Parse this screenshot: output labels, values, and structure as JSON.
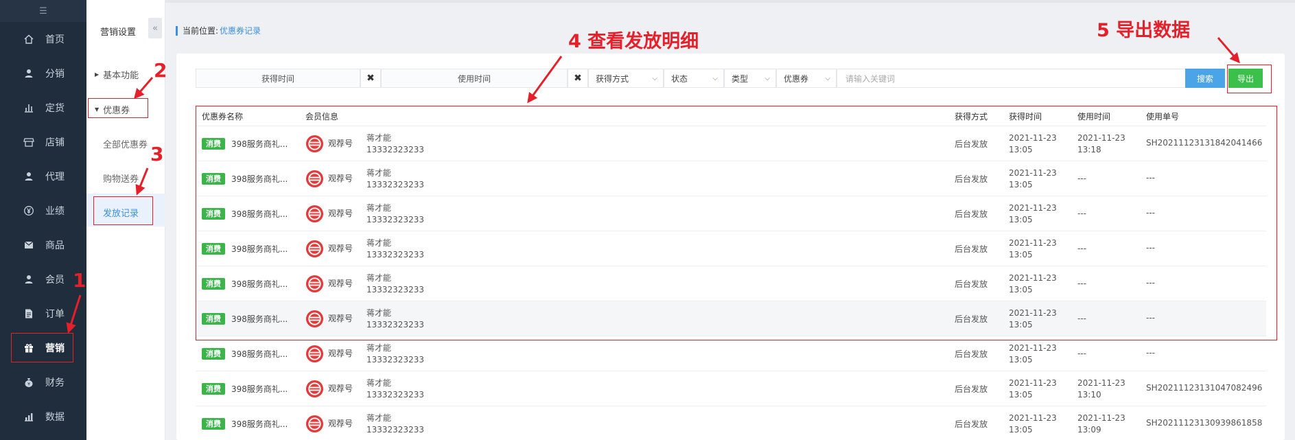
{
  "sidebar": {
    "toggle_icon": "menu-collapse-icon",
    "items": [
      {
        "label": "首页",
        "icon": "home-icon",
        "active": false
      },
      {
        "label": "分销",
        "icon": "user-icon",
        "active": false
      },
      {
        "label": "定货",
        "icon": "bar-chart-icon",
        "active": false
      },
      {
        "label": "店铺",
        "icon": "store-icon",
        "active": false
      },
      {
        "label": "代理",
        "icon": "user-icon",
        "active": false
      },
      {
        "label": "业绩",
        "icon": "yen-icon",
        "active": false
      },
      {
        "label": "商品",
        "icon": "mail-icon",
        "active": false
      },
      {
        "label": "会员",
        "icon": "user-icon",
        "active": false
      },
      {
        "label": "订单",
        "icon": "document-icon",
        "active": false
      },
      {
        "label": "营销",
        "icon": "gift-icon",
        "active": true
      },
      {
        "label": "财务",
        "icon": "money-bag-icon",
        "active": false
      },
      {
        "label": "数据",
        "icon": "stats-icon",
        "active": false
      }
    ]
  },
  "submenu": {
    "title": "营销设置",
    "collapse_icon": "double-chevron-left-icon",
    "groups": [
      {
        "label": "基本功能",
        "expanded": false
      },
      {
        "label": "优惠券",
        "expanded": true
      }
    ],
    "items": [
      {
        "label": "全部优惠券",
        "active": false
      },
      {
        "label": "购物送券",
        "active": false
      },
      {
        "label": "发放记录",
        "active": true
      }
    ]
  },
  "breadcrumb": {
    "prefix": "当前位置:",
    "current": "优惠券记录"
  },
  "filters": {
    "get_time": "获得时间",
    "use_time": "使用时间",
    "clear_symbol": "✖",
    "method": "获得方式",
    "status": "状态",
    "type": "类型",
    "coupon": "优惠券",
    "keyword_placeholder": "请输入关键词",
    "search_label": "搜索",
    "export_label": "导出"
  },
  "table": {
    "headers": {
      "name": "优惠券名称",
      "member": "会员信息",
      "method": "获得方式",
      "get_time": "获得时间",
      "use_time": "使用时间",
      "order_no": "使用单号"
    },
    "rows": [
      {
        "tag": "消费",
        "name": "398服务商礼...",
        "brand": "观荐号",
        "member_name": "蒋才能",
        "phone": "13332323233",
        "method": "后台发放",
        "get_date": "2021-11-23",
        "get_clock": "13:05",
        "use_date": "2021-11-23",
        "use_clock": "13:18",
        "order_no": "SH20211123131842041466"
      },
      {
        "tag": "消费",
        "name": "398服务商礼...",
        "brand": "观荐号",
        "member_name": "蒋才能",
        "phone": "13332323233",
        "method": "后台发放",
        "get_date": "2021-11-23",
        "get_clock": "13:05",
        "use_date": "---",
        "use_clock": "",
        "order_no": "---"
      },
      {
        "tag": "消费",
        "name": "398服务商礼...",
        "brand": "观荐号",
        "member_name": "蒋才能",
        "phone": "13332323233",
        "method": "后台发放",
        "get_date": "2021-11-23",
        "get_clock": "13:05",
        "use_date": "---",
        "use_clock": "",
        "order_no": "---"
      },
      {
        "tag": "消费",
        "name": "398服务商礼...",
        "brand": "观荐号",
        "member_name": "蒋才能",
        "phone": "13332323233",
        "method": "后台发放",
        "get_date": "2021-11-23",
        "get_clock": "13:05",
        "use_date": "---",
        "use_clock": "",
        "order_no": "---"
      },
      {
        "tag": "消费",
        "name": "398服务商礼...",
        "brand": "观荐号",
        "member_name": "蒋才能",
        "phone": "13332323233",
        "method": "后台发放",
        "get_date": "2021-11-23",
        "get_clock": "13:05",
        "use_date": "---",
        "use_clock": "",
        "order_no": "---"
      },
      {
        "tag": "消费",
        "name": "398服务商礼...",
        "brand": "观荐号",
        "member_name": "蒋才能",
        "phone": "13332323233",
        "method": "后台发放",
        "get_date": "2021-11-23",
        "get_clock": "13:05",
        "use_date": "---",
        "use_clock": "",
        "order_no": "---"
      },
      {
        "tag": "消费",
        "name": "398服务商礼...",
        "brand": "观荐号",
        "member_name": "蒋才能",
        "phone": "13332323233",
        "method": "后台发放",
        "get_date": "2021-11-23",
        "get_clock": "13:05",
        "use_date": "---",
        "use_clock": "",
        "order_no": "---"
      },
      {
        "tag": "消费",
        "name": "398服务商礼...",
        "brand": "观荐号",
        "member_name": "蒋才能",
        "phone": "13332323233",
        "method": "后台发放",
        "get_date": "2021-11-23",
        "get_clock": "13:05",
        "use_date": "2021-11-23",
        "use_clock": "13:10",
        "order_no": "SH20211123131047082496"
      },
      {
        "tag": "消费",
        "name": "398服务商礼...",
        "brand": "观荐号",
        "member_name": "蒋才能",
        "phone": "13332323233",
        "method": "后台发放",
        "get_date": "2021-11-23",
        "get_clock": "13:05",
        "use_date": "2021-11-23",
        "use_clock": "13:09",
        "order_no": "SH20211123130939861858"
      }
    ]
  },
  "annotations": {
    "step1": "1",
    "step2": "2",
    "step3": "3",
    "step4": "4 查看发放明细",
    "step5": "5 导出数据",
    "color": "#e4202a"
  },
  "colors": {
    "sidebar_bg": "#1f2d3d",
    "accent_blue": "#3d8fde",
    "export_green": "#3bc04c",
    "tag_green": "#3bb54a",
    "annotation_red": "#e4202a"
  }
}
